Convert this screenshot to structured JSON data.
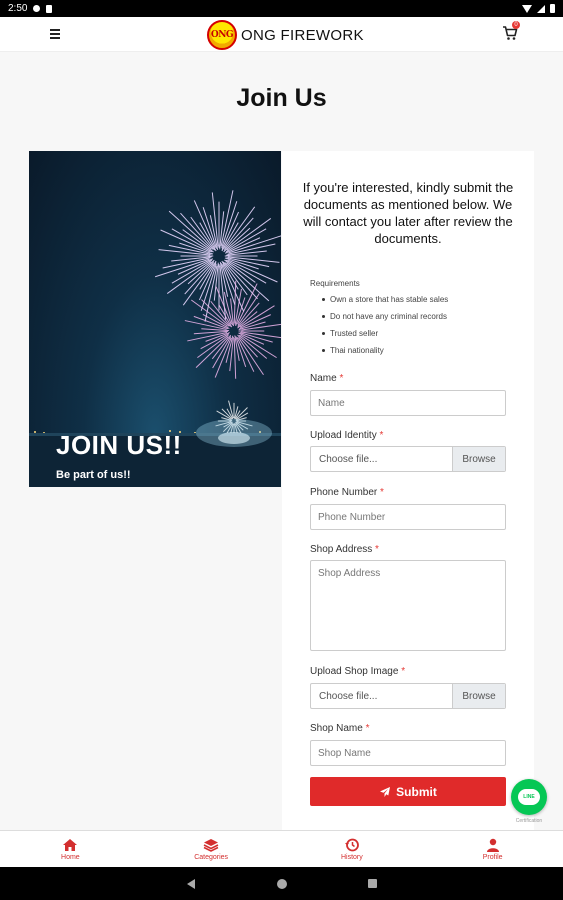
{
  "status_bar": {
    "time": "2:50"
  },
  "header": {
    "brand_name": "ONG FIREWORK",
    "logo_text": "ONG",
    "cart_count": "0"
  },
  "page": {
    "title": "Join Us"
  },
  "hero": {
    "title": "JOIN US!!",
    "subtitle": "Be part of us!!"
  },
  "form": {
    "intro": "If you're interested, kindly submit the documents as mentioned below. We will contact you later after review the documents.",
    "requirements_title": "Requirements",
    "requirements": [
      "Own a store that has stable sales",
      "Do not have any criminal records",
      "Trusted seller",
      "Thai nationality"
    ],
    "fields": {
      "name": {
        "label": "Name",
        "placeholder": "Name"
      },
      "identity": {
        "label": "Upload Identity",
        "file_text": "Choose file...",
        "browse": "Browse"
      },
      "phone": {
        "label": "Phone Number",
        "placeholder": "Phone Number"
      },
      "address": {
        "label": "Shop Address",
        "placeholder": "Shop Address"
      },
      "shop_image": {
        "label": "Upload Shop Image",
        "file_text": "Choose file...",
        "browse": "Browse"
      },
      "shop_name": {
        "label": "Shop Name",
        "placeholder": "Shop Name"
      }
    },
    "required_mark": "*",
    "submit_label": "Submit"
  },
  "fab": {
    "badge_text": "LINE",
    "caption": "Certification"
  },
  "bottom_nav": {
    "items": [
      {
        "label": "Home",
        "icon": "home-icon"
      },
      {
        "label": "Categories",
        "icon": "layers-icon"
      },
      {
        "label": "History",
        "icon": "history-icon"
      },
      {
        "label": "Profile",
        "icon": "profile-icon"
      }
    ]
  },
  "colors": {
    "accent": "#e02a2a",
    "line_green": "#06c755",
    "nav_red": "#d32f2f"
  }
}
